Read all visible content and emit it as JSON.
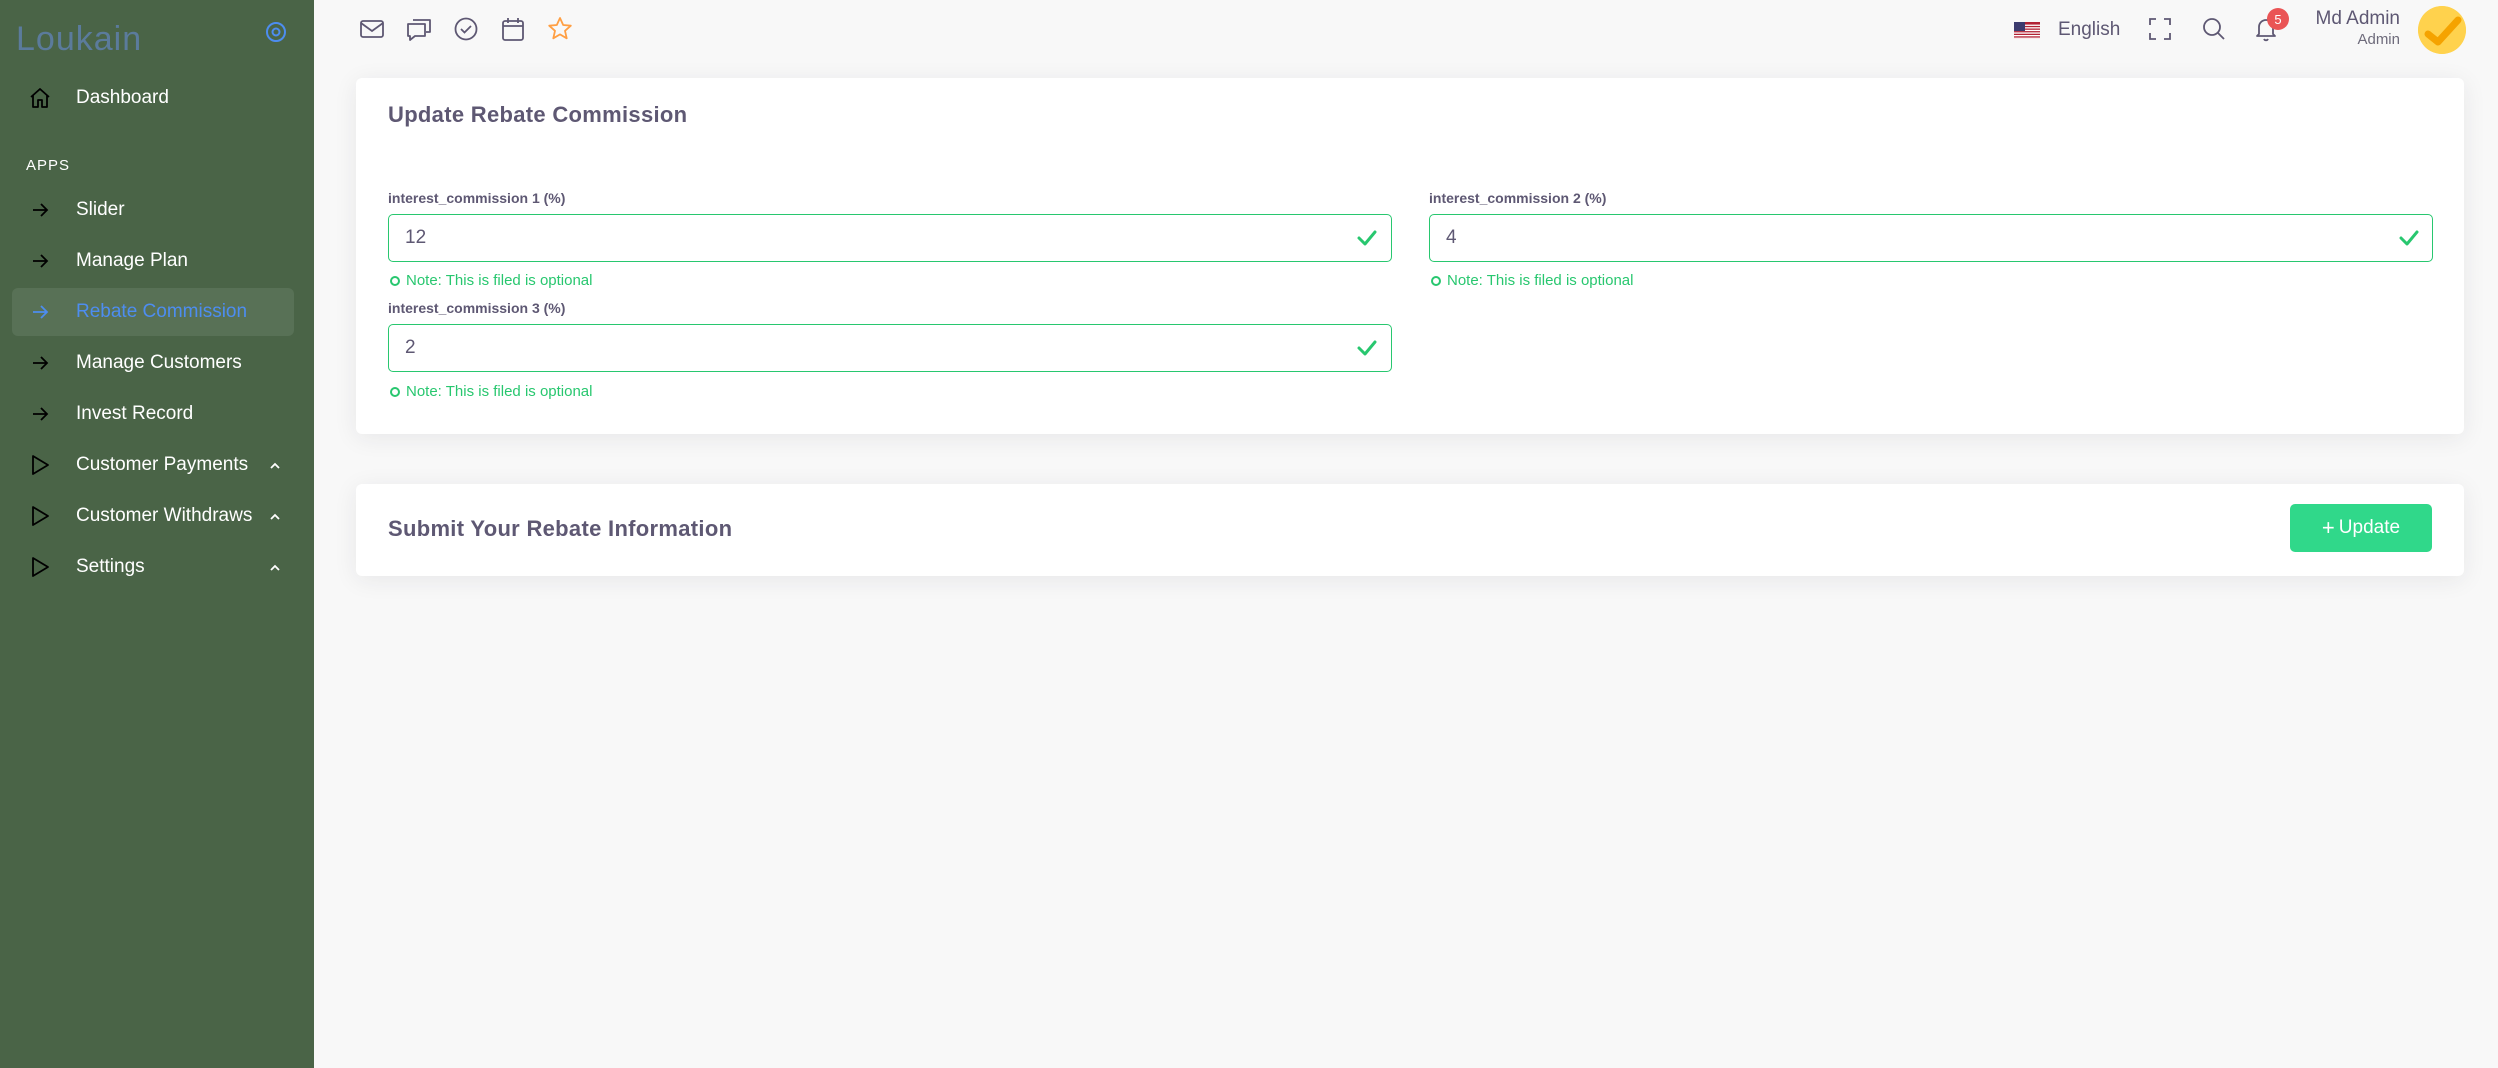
{
  "sidebar": {
    "brand": "Loukain",
    "section_apps": "APPS",
    "items": [
      {
        "label": "Dashboard"
      },
      {
        "label": "Slider"
      },
      {
        "label": "Manage Plan"
      },
      {
        "label": "Rebate Commission"
      },
      {
        "label": "Manage Customers"
      },
      {
        "label": "Invest Record"
      },
      {
        "label": "Customer Payments"
      },
      {
        "label": "Customer Withdraws"
      },
      {
        "label": "Settings"
      }
    ]
  },
  "topbar": {
    "language": "English",
    "notification_count": "5",
    "user_name": "Md Admin",
    "user_role": "Admin"
  },
  "form": {
    "title": "Update Rebate Commission",
    "fields": [
      {
        "label": "interest_commission 1 (%)",
        "value": "12",
        "note": "Note: This is filed is optional"
      },
      {
        "label": "interest_commission 2 (%)",
        "value": "4",
        "note": "Note: This is filed is optional"
      },
      {
        "label": "interest_commission 3 (%)",
        "value": "2",
        "note": "Note: This is filed is optional"
      }
    ]
  },
  "submit": {
    "title": "Submit Your Rebate Information",
    "button_plus": "+",
    "button_label": "Update"
  },
  "colors": {
    "sidebar_bg": "#4a6447",
    "accent": "#28c76f",
    "active_link": "#4d8df0",
    "badge": "#ea5455"
  }
}
